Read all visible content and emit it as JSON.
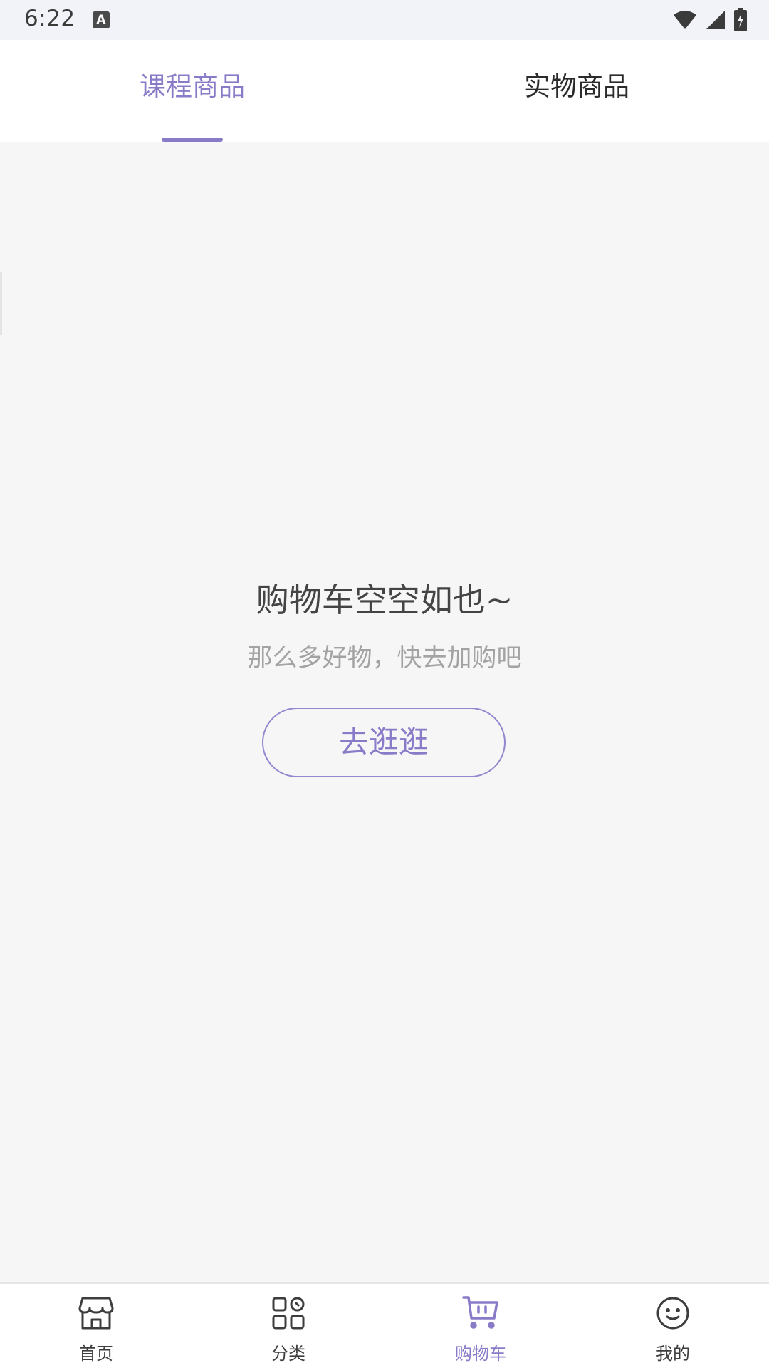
{
  "status_bar": {
    "time": "6:22",
    "notification_icon_letter": "A",
    "icons": [
      "wifi-icon",
      "signal-icon",
      "battery-charging-icon"
    ]
  },
  "tabs": [
    {
      "label": "课程商品",
      "active": true
    },
    {
      "label": "实物商品",
      "active": false
    }
  ],
  "empty_state": {
    "title": "购物车空空如也~",
    "subtitle": "那么多好物，快去加购吧",
    "button_label": "去逛逛"
  },
  "bottom_nav": [
    {
      "label": "首页",
      "icon": "store-icon",
      "active": false
    },
    {
      "label": "分类",
      "icon": "category-grid-icon",
      "active": false
    },
    {
      "label": "购物车",
      "icon": "cart-icon",
      "active": true
    },
    {
      "label": "我的",
      "icon": "smiley-face-icon",
      "active": false
    }
  ],
  "colors": {
    "accent": "#8a7bc8",
    "background": "#f6f6f7",
    "text_primary": "#444444",
    "text_secondary": "#a3a3a3"
  }
}
